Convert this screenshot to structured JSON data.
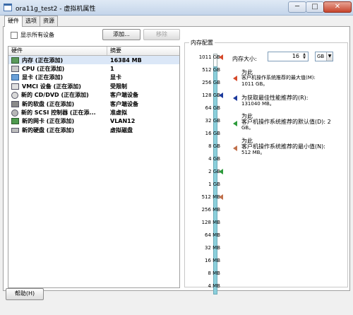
{
  "window": {
    "title": "ora11g_test2 - 虚拟机属性",
    "minimize": "─",
    "maximize": "□",
    "close": "✕"
  },
  "tabs": [
    {
      "label": "硬件",
      "active": true
    },
    {
      "label": "选项",
      "active": false
    },
    {
      "label": "资源",
      "active": false
    }
  ],
  "left": {
    "show_all_label": "显示所有设备",
    "add_button": "添加...",
    "remove_button": "移除",
    "table": {
      "headers": [
        "硬件",
        "摘要"
      ],
      "rows": [
        {
          "icon": "memory-icon",
          "name": "内存 (正在添加)",
          "summary": "16384 MB",
          "selected": true
        },
        {
          "icon": "cpu-icon",
          "name": "CPU (正在添加)",
          "summary": "1"
        },
        {
          "icon": "display-icon",
          "name": "显卡 (正在添加)",
          "summary": "显卡"
        },
        {
          "icon": "vmci-icon",
          "name": "VMCI 设备 (正在添加)",
          "summary": "受限制"
        },
        {
          "icon": "cd-dvd-icon",
          "name": "新的 CD/DVD (正在添加)",
          "summary": "客户端设备"
        },
        {
          "icon": "floppy-icon",
          "name": "新的软盘 (正在添加)",
          "summary": "客户端设备"
        },
        {
          "icon": "scsi-icon",
          "name": "新的 SCSI 控制器 (正在添...",
          "summary": "准虚拟"
        },
        {
          "icon": "network-icon",
          "name": "新的网卡 (正在添加)",
          "summary": "VLAN12"
        },
        {
          "icon": "hard-disk-icon",
          "name": "新的硬盘 (正在添加)",
          "summary": "虚拟磁盘"
        }
      ]
    }
  },
  "right": {
    "group_title": "内存配置",
    "mem_size_label": "内存大小:",
    "mem_size_value": "16",
    "mem_unit": "GB",
    "scale_ticks": [
      "1011 GB",
      "512 GB",
      "256 GB",
      "128 GB",
      "64 GB",
      "32 GB",
      "16 GB",
      "8 GB",
      "4 GB",
      "2 GB",
      "1 GB",
      "512 MB",
      "256 MB",
      "128 MB",
      "64 MB",
      "32 MB",
      "16 MB",
      "8 MB",
      "4 MB"
    ],
    "info": [
      {
        "color": "red",
        "line1": "为此",
        "line2": "客户机操作系统推荐的最大值(M):",
        "line3": "1011 GB。"
      },
      {
        "color": "blue",
        "line1": "为获取最佳性能推荐的(R):",
        "line2": "131040 MB。",
        "line3": ""
      },
      {
        "color": "green",
        "line1": "为此",
        "line2": "客户机操作系统推荐的默认值(D): 2",
        "line3": "GB。"
      },
      {
        "color": "brown",
        "line1": "为此",
        "line2": "客户机操作系统推荐的最小值(N):",
        "line3": "512 MB。"
      }
    ]
  },
  "footer": {
    "help_button": "帮助(H)"
  }
}
